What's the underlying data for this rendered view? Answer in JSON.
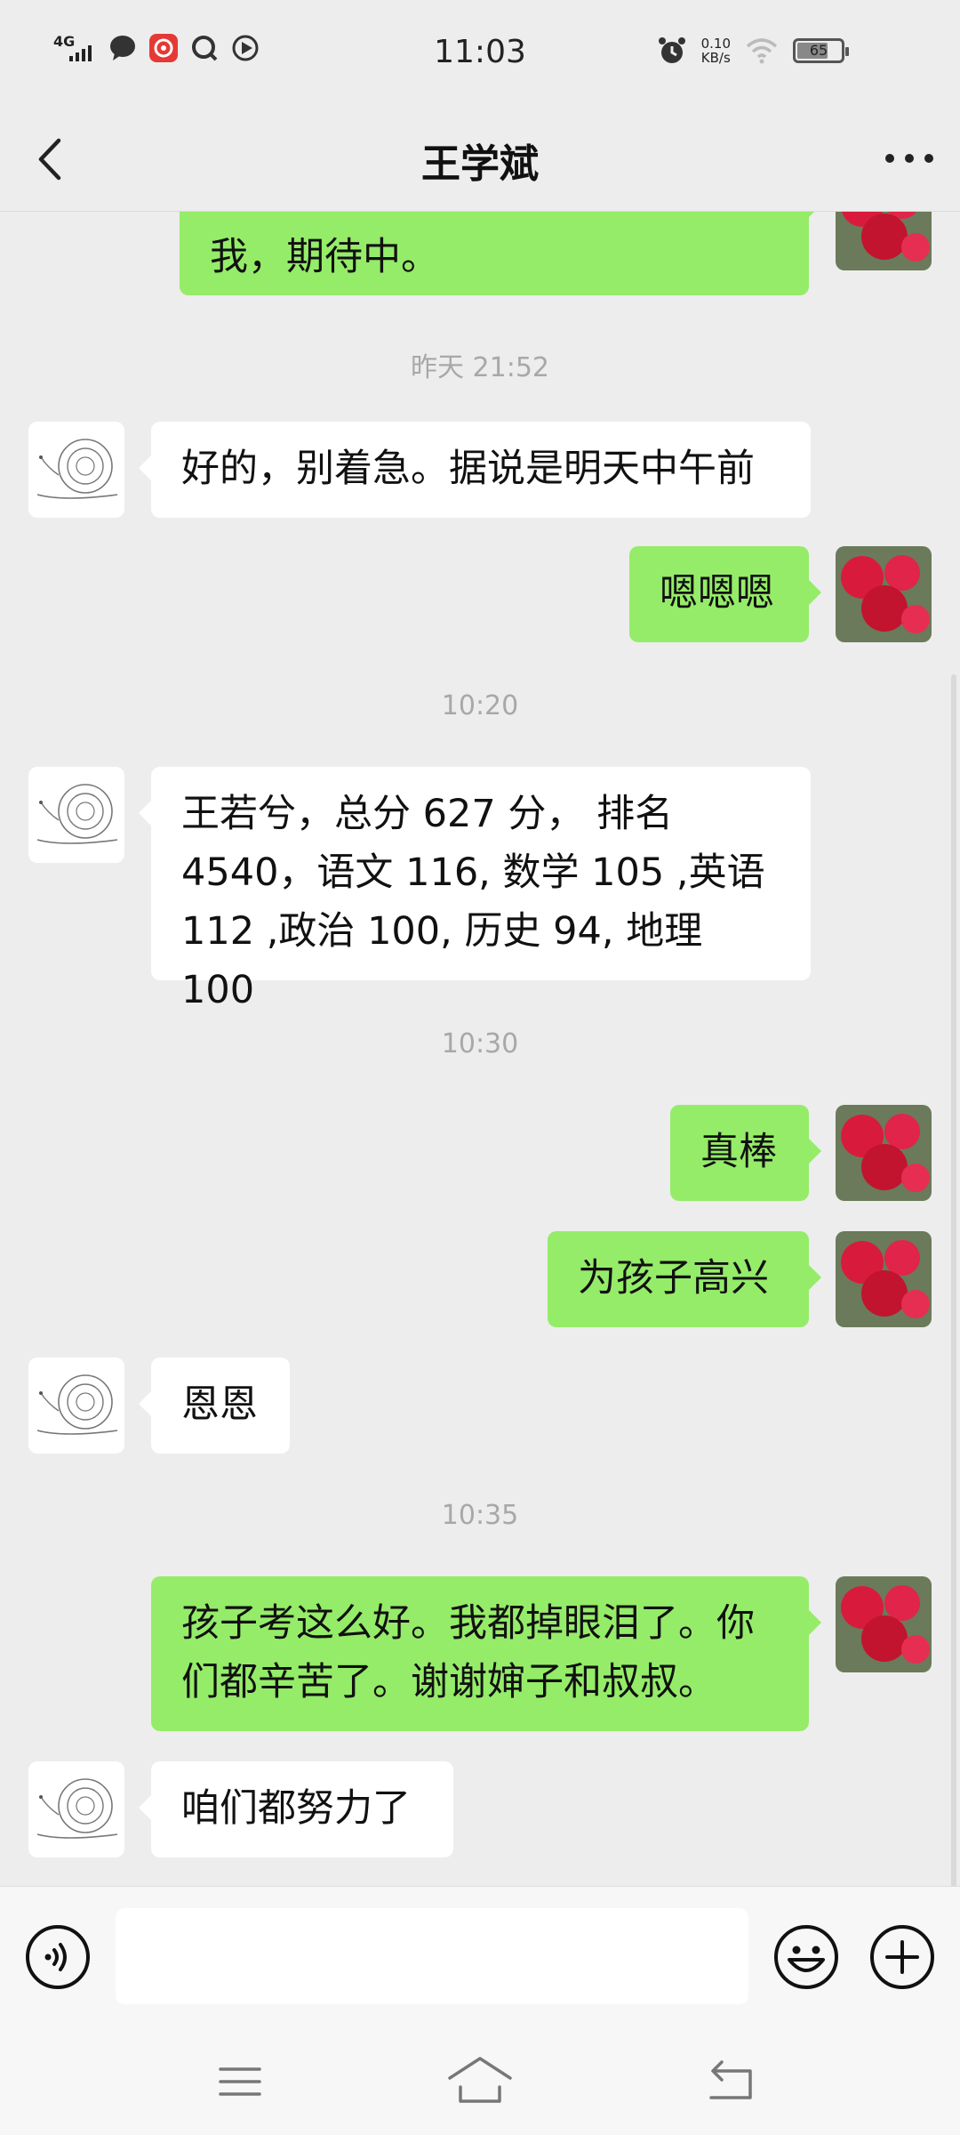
{
  "status_bar": {
    "network": "4G",
    "time": "11:03",
    "speed_value": "0.10",
    "speed_unit": "KB/s",
    "battery": "65"
  },
  "nav": {
    "title": "王学斌",
    "back_icon": "chevron-left-icon",
    "more_icon": "more-dots-icon"
  },
  "messages": [
    {
      "kind": "out",
      "text": "我，期待中。"
    },
    {
      "kind": "time",
      "text": "昨天 21:52"
    },
    {
      "kind": "in",
      "text": "好的，别着急。据说是明天中午前"
    },
    {
      "kind": "out",
      "text": "嗯嗯嗯"
    },
    {
      "kind": "time",
      "text": "10:20"
    },
    {
      "kind": "in",
      "lines": [
        "王若兮，总分 627 分，  排名",
        "4540，语文 116, 数学 105 ,英语",
        "112 ,政治 100, 历史 94, 地理 100"
      ]
    },
    {
      "kind": "time",
      "text": "10:30"
    },
    {
      "kind": "out",
      "text": "真棒"
    },
    {
      "kind": "out",
      "text": "为孩子高兴"
    },
    {
      "kind": "in",
      "text": "恩恩"
    },
    {
      "kind": "time",
      "text": "10:35"
    },
    {
      "kind": "out",
      "lines": [
        "孩子考这么好。我都掉眼泪了。你",
        "们都辛苦了。谢谢婶子和叔叔。"
      ]
    },
    {
      "kind": "in",
      "text": "咱们都努力了"
    }
  ],
  "input_bar": {
    "voice_icon": "voice-icon",
    "emoji_icon": "emoji-icon",
    "plus_icon": "plus-icon",
    "value": ""
  },
  "colors": {
    "outgoing_bubble": "#95ec69",
    "incoming_bubble": "#ffffff",
    "background": "#ededed"
  }
}
